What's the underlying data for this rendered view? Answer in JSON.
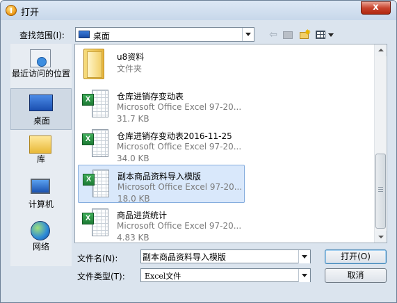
{
  "window": {
    "title": "打开",
    "close_label": "x"
  },
  "toolbar": {
    "look_in_label": "查找范围(I):",
    "look_in_value": "桌面",
    "back_glyph": "⇦"
  },
  "places": [
    {
      "label": "最近访问的位置",
      "icon": "recent-places-icon"
    },
    {
      "label": "桌面",
      "icon": "desktop-icon",
      "selected": true
    },
    {
      "label": "库",
      "icon": "libraries-icon"
    },
    {
      "label": "计算机",
      "icon": "computer-icon"
    },
    {
      "label": "网络",
      "icon": "network-icon"
    }
  ],
  "files": [
    {
      "name": "u8资料",
      "type": "文件夹",
      "size": "",
      "kind": "folder"
    },
    {
      "name": "仓库进销存变动表",
      "type": "Microsoft Office Excel 97-20...",
      "size": "31.7 KB",
      "kind": "excel"
    },
    {
      "name": "仓库进销存变动表2016-11-25",
      "type": "Microsoft Office Excel 97-20...",
      "size": "34.0 KB",
      "kind": "excel"
    },
    {
      "name": "副本商品资料导入模版",
      "type": "Microsoft Office Excel 97-20...",
      "size": "18.0 KB",
      "kind": "excel",
      "selected": true
    },
    {
      "name": "商品进货统计",
      "type": "Microsoft Office Excel 97-20...",
      "size": "4.83 KB",
      "kind": "excel"
    }
  ],
  "form": {
    "file_name_label": "文件名(N):",
    "file_name_value": "副本商品资料导入模版",
    "file_type_label": "文件类型(T):",
    "file_type_value": "Excel文件",
    "open_label": "打开(O)",
    "cancel_label": "取消"
  },
  "colors": {
    "selection": "#d9e8fb",
    "selection_border": "#84acdd",
    "window_bg": "#dbe4ee"
  }
}
